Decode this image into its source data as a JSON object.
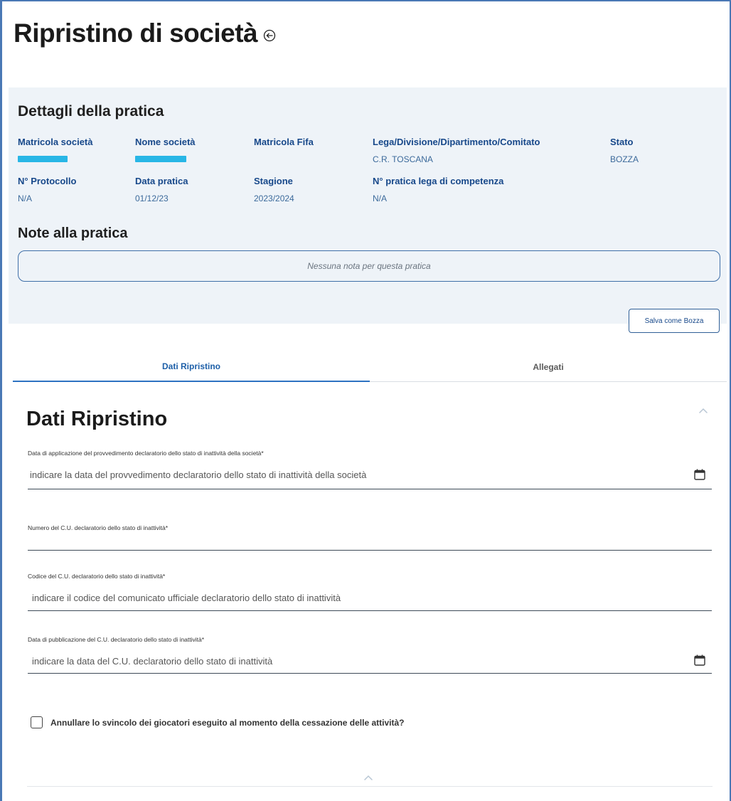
{
  "header": {
    "title": "Ripristino di società"
  },
  "details": {
    "section_title": "Dettagli della pratica",
    "fields": [
      {
        "label": "Matricola società",
        "value": ""
      },
      {
        "label": "Nome società",
        "value": ""
      },
      {
        "label": "Matricola Fifa",
        "value": ""
      },
      {
        "label": "Lega/Divisione/Dipartimento/Comitato",
        "value": "C.R. TOSCANA"
      },
      {
        "label": "Stato",
        "value": "BOZZA"
      },
      {
        "label": "N° Protocollo",
        "value": "N/A"
      },
      {
        "label": "Data pratica",
        "value": "01/12/23"
      },
      {
        "label": "Stagione",
        "value": "2023/2024"
      },
      {
        "label": "N° pratica lega di competenza",
        "value": "N/A"
      }
    ],
    "notes_title": "Note alla pratica",
    "notes_placeholder": "Nessuna nota per questa pratica",
    "save_draft_label": "Salva come Bozza"
  },
  "tabs": [
    {
      "label": "Dati Ripristino",
      "active": true
    },
    {
      "label": "Allegati",
      "active": false
    }
  ],
  "form": {
    "title": "Dati Ripristino",
    "fields": [
      {
        "label": "Data di applicazione del provvedimento declaratorio dello stato di inattività della società*",
        "placeholder": "indicare la data del provvedimento declaratorio dello stato di inattività della società"
      },
      {
        "label": "Numero del C.U. declaratorio dello stato di inattività*",
        "placeholder": ""
      },
      {
        "label": "Codice del C.U. declaratorio dello stato di inattività*",
        "placeholder": "indicare il codice del comunicato ufficiale declaratorio dello stato di inattività"
      },
      {
        "label": "Data di pubblicazione del C.U. declaratorio dello stato di inattività*",
        "placeholder": "indicare la data del C.U. declaratorio dello stato di inattività"
      }
    ],
    "checkbox_label": "Annullare lo svincolo dei giocatori eseguito al momento della cessazione delle attività?",
    "checkbox_checked": false
  },
  "colors": {
    "accent": "#1d5fa8",
    "label_blue": "#17488a",
    "panel_bg": "#eef3f8",
    "redaction": "#28b6e6"
  }
}
